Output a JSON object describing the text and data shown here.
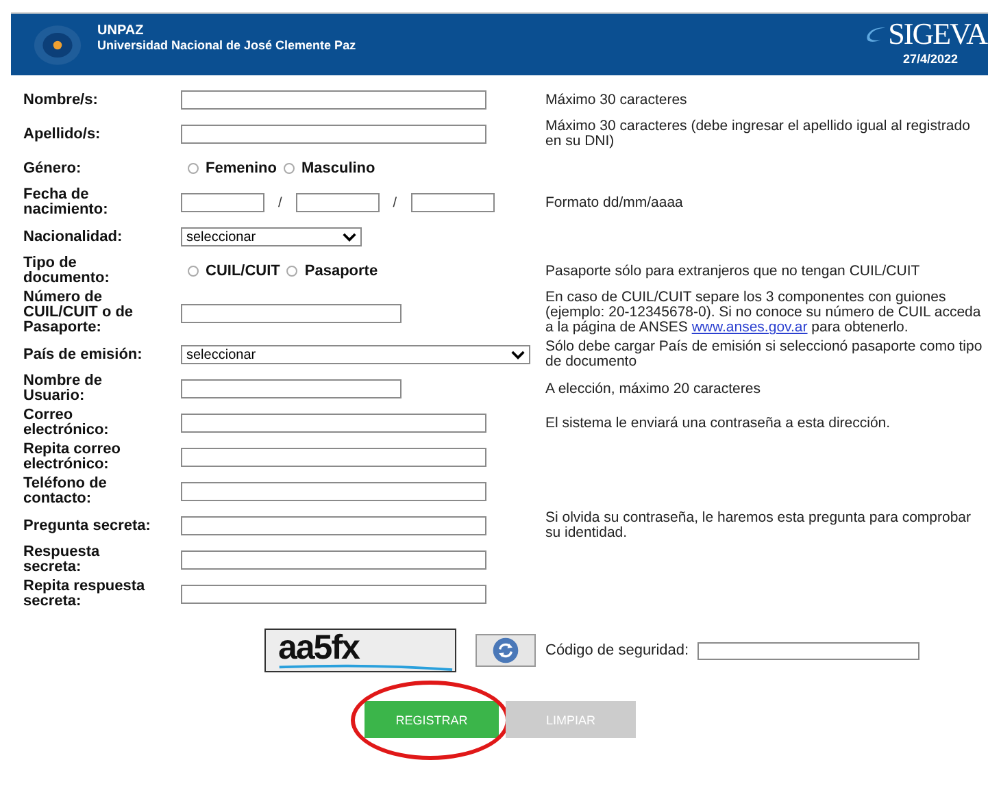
{
  "header": {
    "org_short": "UNPAZ",
    "org_name": "Universidad Nacional de José Clemente Paz",
    "system": "SIGEVA",
    "date": "27/4/2022"
  },
  "rows": [
    {
      "kind": "text",
      "label": "Nombre/s:",
      "help": "Máximo 30 caracteres"
    },
    {
      "kind": "text",
      "label": "Apellido/s:",
      "help": "Máximo 30 caracteres (debe ingresar el apellido igual al registrado en su DNI)"
    },
    {
      "kind": "radio",
      "label": "Género:",
      "options": [
        {
          "label": "Femenino",
          "selected": false
        },
        {
          "label": "Masculino",
          "selected": false
        }
      ]
    },
    {
      "kind": "date",
      "label": "Fecha de nacimiento:",
      "separator": "/",
      "help": "Formato dd/mm/aaaa"
    },
    {
      "kind": "select",
      "label": "Nacionalidad:",
      "value": "seleccionar"
    },
    {
      "kind": "radio",
      "label": "Tipo de documento:",
      "options": [
        {
          "label": "CUIL/CUIT",
          "selected": false
        },
        {
          "label": "Pasaporte",
          "selected": false
        }
      ],
      "help": "Pasaporte sólo para extranjeros que no tengan CUIL/CUIT"
    },
    {
      "kind": "text_short",
      "label": "Número de CUIL/CUIT o de Pasaporte:",
      "help": "En caso de CUIL/CUIT separe los 3 componentes con guiones (ejemplo: 20-12345678-0). Si no conoce su número de CUIL acceda a la página de ANSES ",
      "help_link": "www.anses.gov.ar",
      "help_after": " para obtenerlo."
    },
    {
      "kind": "select_wide",
      "label": "País de emisión:",
      "value": "seleccionar",
      "help": "Sólo debe cargar País de emisión si seleccionó pasaporte como tipo de documento"
    },
    {
      "kind": "text_short",
      "label": "Nombre de Usuario:",
      "help": "A elección, máximo 20 caracteres"
    },
    {
      "kind": "text",
      "label": "Correo electrónico:",
      "help": "El sistema le enviará una contraseña a esta dirección."
    },
    {
      "kind": "text",
      "label": "Repita correo electrónico:"
    },
    {
      "kind": "text",
      "label": "Teléfono de contacto:"
    },
    {
      "kind": "text",
      "label": "Pregunta secreta:",
      "help": "Si olvida su contraseña, le haremos esta pregunta para comprobar su identidad."
    },
    {
      "kind": "text",
      "label": "Respuesta secreta:"
    },
    {
      "kind": "text",
      "label": "Repita respuesta secreta:"
    }
  ],
  "captcha": {
    "code": "aa5fx",
    "label": "Código de seguridad:"
  },
  "buttons": [
    {
      "label": "REGISTRAR",
      "disabled": false,
      "circled": true
    },
    {
      "label": "LIMPIAR",
      "disabled": true,
      "circled": false
    }
  ]
}
